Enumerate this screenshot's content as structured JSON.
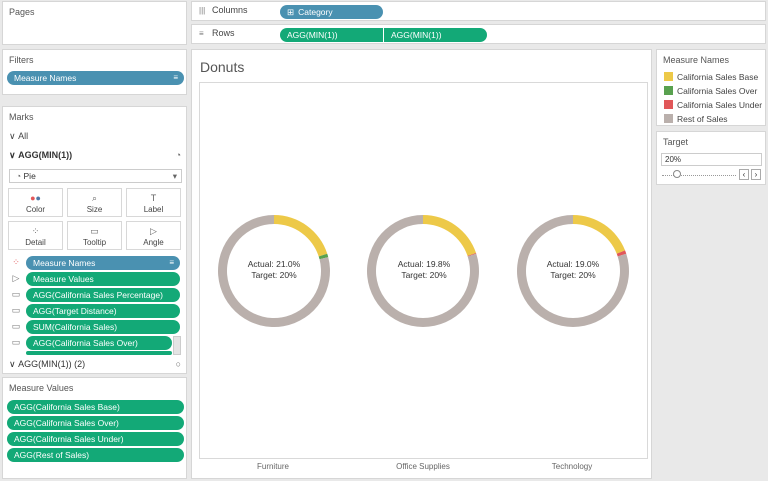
{
  "pages": {
    "title": "Pages"
  },
  "columns": {
    "label": "Columns",
    "pill": "Category"
  },
  "rows": {
    "label": "Rows",
    "pills": [
      "AGG(MIN(1))",
      "AGG(MIN(1))"
    ]
  },
  "filters": {
    "title": "Filters",
    "pill": "Measure Names"
  },
  "marks": {
    "title": "Marks",
    "all_label": "All",
    "section1": "AGG(MIN(1))",
    "mark_type": "Pie",
    "buttons": [
      "Color",
      "Size",
      "Label",
      "Detail",
      "Tooltip",
      "Angle"
    ],
    "fields": [
      {
        "label": "Measure Names",
        "style": "blue",
        "icon": "color-icon"
      },
      {
        "label": "Measure Values",
        "style": "green",
        "icon": "angle-icon"
      },
      {
        "label": "AGG(California Sales Percentage)",
        "style": "green",
        "icon": "tooltip-icon"
      },
      {
        "label": "AGG(Target Distance)",
        "style": "green",
        "icon": "tooltip-icon"
      },
      {
        "label": "SUM(California Sales)",
        "style": "green",
        "icon": "tooltip-icon"
      },
      {
        "label": "AGG(California Sales Over)",
        "style": "green",
        "icon": "tooltip-icon"
      }
    ],
    "section2": "AGG(MIN(1)) (2)"
  },
  "measure_values": {
    "title": "Measure Values",
    "items": [
      "AGG(California Sales Base)",
      "AGG(California Sales Over)",
      "AGG(California Sales Under)",
      "AGG(Rest of Sales)"
    ]
  },
  "view": {
    "title": "Donuts"
  },
  "legend": {
    "title": "Measure Names",
    "items": [
      {
        "label": "California Sales Base",
        "color": "#edc948"
      },
      {
        "label": "California Sales Over",
        "color": "#59a14f"
      },
      {
        "label": "California Sales Under",
        "color": "#e15759"
      },
      {
        "label": "Rest of Sales",
        "color": "#bab0ac"
      }
    ]
  },
  "target": {
    "title": "Target",
    "value": "20%",
    "slider_fraction": 0.2
  },
  "chart_data": {
    "type": "pie",
    "categories": [
      "Furniture",
      "Office Supplies",
      "Technology"
    ],
    "series_order": [
      "California Sales Base",
      "California Sales Over",
      "California Sales Under",
      "Rest of Sales"
    ],
    "series_colors": [
      "#edc948",
      "#59a14f",
      "#e15759",
      "#bab0ac"
    ],
    "donuts": [
      {
        "category": "Furniture",
        "actual_text": "Actual: 21.0%",
        "target_text": "Target: 20%",
        "values": [
          20.0,
          1.0,
          0.0,
          79.0
        ]
      },
      {
        "category": "Office Supplies",
        "actual_text": "Actual: 19.8%",
        "target_text": "Target: 20%",
        "values": [
          19.8,
          0.0,
          0.2,
          80.0
        ]
      },
      {
        "category": "Technology",
        "actual_text": "Actual: 19.0%",
        "target_text": "Target: 20%",
        "values": [
          19.0,
          0.0,
          1.0,
          80.0
        ]
      }
    ]
  }
}
